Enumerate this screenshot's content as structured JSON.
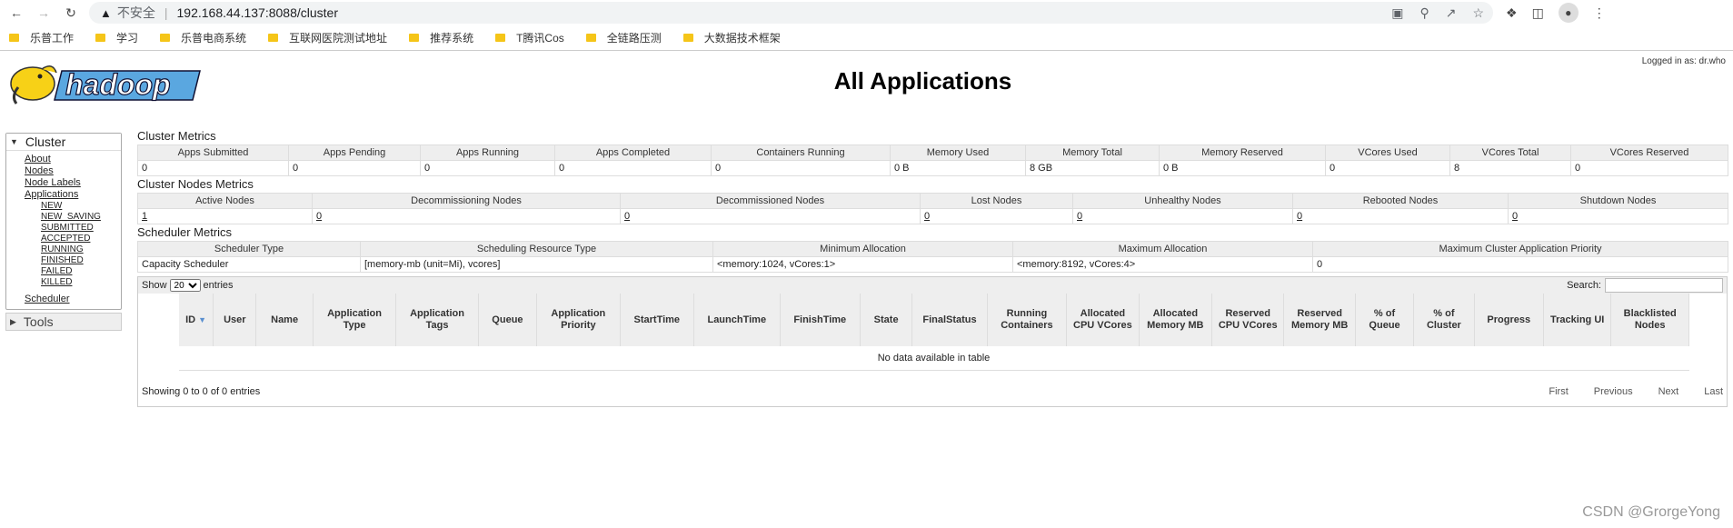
{
  "browser": {
    "insecure_label": "不安全",
    "url": "192.168.44.137:8088/cluster"
  },
  "bookmarks": [
    "乐普工作",
    "学习",
    "乐普电商系统",
    "互联网医院测试地址",
    "推荐系统",
    "T腾讯Cos",
    "全链路压测",
    "大数据技术框架"
  ],
  "header": {
    "title": "All Applications",
    "logged_in": "Logged in as: dr.who"
  },
  "sidebar": {
    "cluster_label": "Cluster",
    "links": [
      "About",
      "Nodes",
      "Node Labels",
      "Applications"
    ],
    "app_states": [
      "NEW",
      "NEW_SAVING",
      "SUBMITTED",
      "ACCEPTED",
      "RUNNING",
      "FINISHED",
      "FAILED",
      "KILLED"
    ],
    "scheduler_label": "Scheduler",
    "tools_label": "Tools"
  },
  "cluster_metrics": {
    "title": "Cluster Metrics",
    "headers": [
      "Apps Submitted",
      "Apps Pending",
      "Apps Running",
      "Apps Completed",
      "Containers Running",
      "Memory Used",
      "Memory Total",
      "Memory Reserved",
      "VCores Used",
      "VCores Total",
      "VCores Reserved"
    ],
    "values": [
      "0",
      "0",
      "0",
      "0",
      "0",
      "0 B",
      "8 GB",
      "0 B",
      "0",
      "8",
      "0"
    ]
  },
  "node_metrics": {
    "title": "Cluster Nodes Metrics",
    "headers": [
      "Active Nodes",
      "Decommissioning Nodes",
      "Decommissioned Nodes",
      "Lost Nodes",
      "Unhealthy Nodes",
      "Rebooted Nodes",
      "Shutdown Nodes"
    ],
    "values": [
      "1",
      "0",
      "0",
      "0",
      "0",
      "0",
      "0"
    ]
  },
  "scheduler_metrics": {
    "title": "Scheduler Metrics",
    "headers": [
      "Scheduler Type",
      "Scheduling Resource Type",
      "Minimum Allocation",
      "Maximum Allocation",
      "Maximum Cluster Application Priority"
    ],
    "values": [
      "Capacity Scheduler",
      "[memory-mb (unit=Mi), vcores]",
      "<memory:1024, vCores:1>",
      "<memory:8192, vCores:4>",
      "0"
    ]
  },
  "apps_table": {
    "show_label": "Show",
    "entries_label": "entries",
    "page_size": "20",
    "search_label": "Search:",
    "columns": [
      "ID",
      "User",
      "Name",
      "Application Type",
      "Application Tags",
      "Queue",
      "Application Priority",
      "StartTime",
      "LaunchTime",
      "FinishTime",
      "State",
      "FinalStatus",
      "Running Containers",
      "Allocated CPU VCores",
      "Allocated Memory MB",
      "Reserved CPU VCores",
      "Reserved Memory MB",
      "% of Queue",
      "% of Cluster",
      "Progress",
      "Tracking UI",
      "Blacklisted Nodes"
    ],
    "empty_message": "No data available in table",
    "info": "Showing 0 to 0 of 0 entries",
    "pager": [
      "First",
      "Previous",
      "Next",
      "Last"
    ]
  },
  "watermark": "CSDN @GrorgeYong"
}
